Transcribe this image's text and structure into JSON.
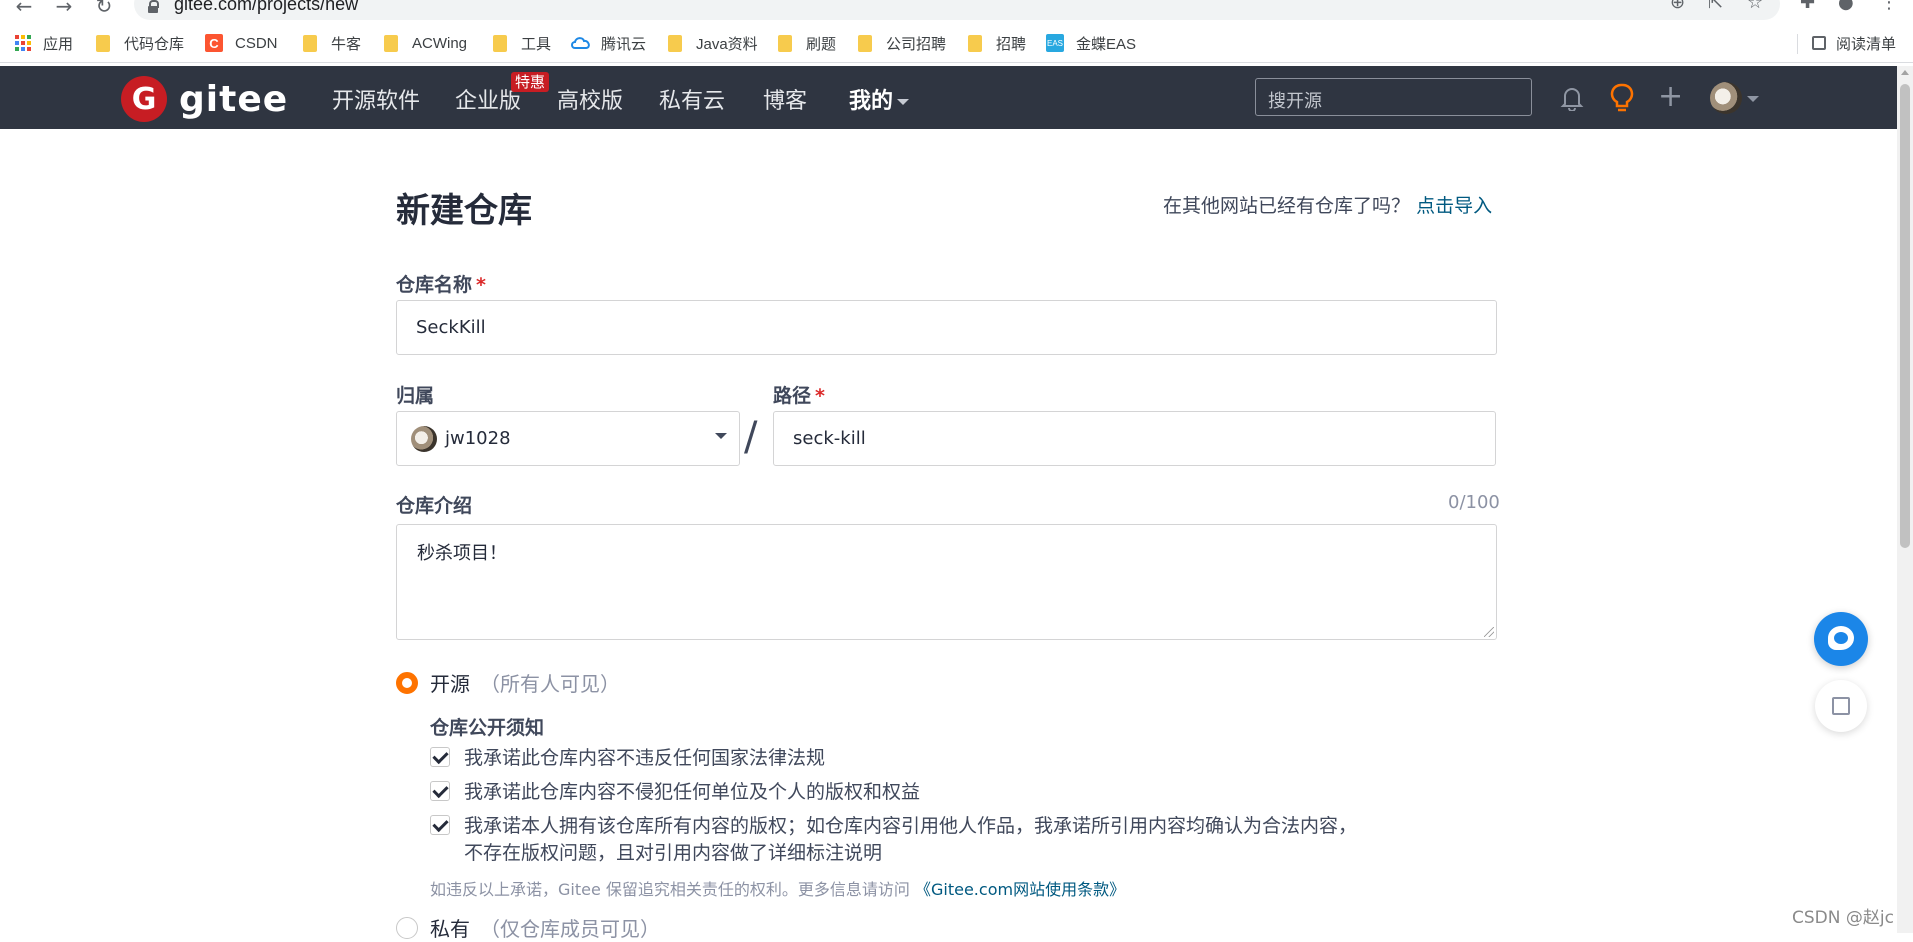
{
  "browser": {
    "url": "gitee.com/projects/new",
    "bookmarks": [
      {
        "label": "应用",
        "icon": "apps-grid-icon"
      },
      {
        "label": "代码仓库",
        "icon": "folder-icon"
      },
      {
        "label": "CSDN",
        "icon": "csdn-icon"
      },
      {
        "label": "牛客",
        "icon": "folder-icon"
      },
      {
        "label": "ACWing",
        "icon": "folder-icon"
      },
      {
        "label": "工具",
        "icon": "folder-icon"
      },
      {
        "label": "腾讯云",
        "icon": "cloud-icon"
      },
      {
        "label": "Java资料",
        "icon": "folder-icon"
      },
      {
        "label": "刷题",
        "icon": "folder-icon"
      },
      {
        "label": "公司招聘",
        "icon": "folder-icon"
      },
      {
        "label": "招聘",
        "icon": "folder-icon"
      },
      {
        "label": "金蝶EAS",
        "icon": "eas-icon"
      }
    ],
    "reading_list": "阅读清单"
  },
  "header": {
    "logo_mark": "G",
    "logo_text": "gitee",
    "nav": [
      "开源软件",
      "企业版",
      "高校版",
      "私有云",
      "博客",
      "我的"
    ],
    "hot_badge": "特惠",
    "search_placeholder": "搜开源",
    "colors": {
      "background": "#2f3541",
      "brand": "#c71d23",
      "bulb": "#fe7300"
    }
  },
  "form": {
    "title": "新建仓库",
    "import_tip": "在其他网站已经有仓库了吗？",
    "import_link": "点击导入",
    "repo_name_label": "仓库名称",
    "required_mark": "*",
    "repo_name_value": "SeckKill",
    "owner_label": "归属",
    "owner_value": "jw1028",
    "path_label": "路径",
    "path_value": "seck-kill",
    "separator": "/",
    "desc_label": "仓库介绍",
    "desc_counter": "0/100",
    "desc_value": "秒杀项目！",
    "public_label": "开源",
    "public_hint": "（所有人可见）",
    "notice_title": "仓库公开须知",
    "checks": [
      "我承诺此仓库内容不违反任何国家法律法规",
      "我承诺此仓库内容不侵犯任何单位及个人的版权和权益",
      "我承诺本人拥有该仓库所有内容的版权；如仓库内容引用他人作品，我承诺所引用内容均确认为合法内容，",
      "不存在版权问题，且对引用内容做了详细标注说明"
    ],
    "legal_text": "如违反以上承诺，Gitee 保留追究相关责任的权利。更多信息请访问",
    "legal_link": "《Gitee.com网站使用条款》",
    "private_label": "私有",
    "private_hint": "（仅仓库成员可见）",
    "accent": "#fe7300",
    "link_color": "#005980"
  },
  "watermark": "CSDN @赵jc"
}
